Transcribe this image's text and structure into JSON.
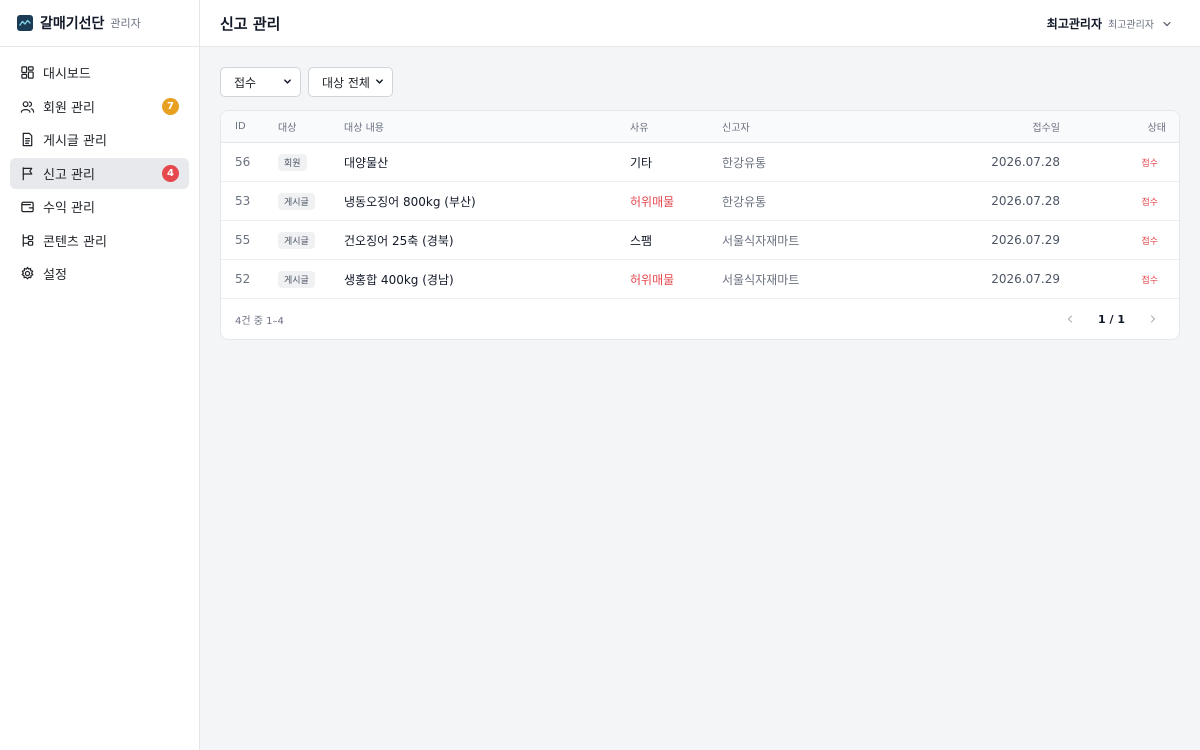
{
  "brand": {
    "name": "갈매기선단",
    "sub": "관리자"
  },
  "sidebar": {
    "items": [
      {
        "label": "대시보드",
        "icon": "dashboard-icon",
        "active": false,
        "badge": null
      },
      {
        "label": "회원 관리",
        "icon": "users-icon",
        "active": false,
        "badge": "7",
        "badge_color": "#e8a021"
      },
      {
        "label": "게시글 관리",
        "icon": "document-icon",
        "active": false,
        "badge": null
      },
      {
        "label": "신고 관리",
        "icon": "flag-icon",
        "active": true,
        "badge": "4",
        "badge_color": "#e5484d"
      },
      {
        "label": "수익 관리",
        "icon": "wallet-icon",
        "active": false,
        "badge": null
      },
      {
        "label": "콘텐츠 관리",
        "icon": "tree-icon",
        "active": false,
        "badge": null
      },
      {
        "label": "설정",
        "icon": "gear-icon",
        "active": false,
        "badge": null
      }
    ]
  },
  "header": {
    "title": "신고 관리",
    "user_name": "최고관리자",
    "user_role": "최고관리자"
  },
  "filters": {
    "status": "접수",
    "target": "대상 전체"
  },
  "table": {
    "columns": {
      "id": "ID",
      "type": "대상",
      "content": "대상 내용",
      "reason": "사유",
      "reporter": "신고자",
      "date": "접수일",
      "status": "상태"
    },
    "rows": [
      {
        "id": "56",
        "type": "회원",
        "content": "대양물산",
        "reason": "기타",
        "reason_alert": false,
        "reporter": "한강유통",
        "date": "2026.07.28",
        "status": "접수"
      },
      {
        "id": "53",
        "type": "게시글",
        "content": "냉동오징어 800kg (부산)",
        "reason": "허위매물",
        "reason_alert": true,
        "reporter": "한강유통",
        "date": "2026.07.28",
        "status": "접수"
      },
      {
        "id": "55",
        "type": "게시글",
        "content": "건오징어 25축 (경북)",
        "reason": "스팸",
        "reason_alert": false,
        "reporter": "서울식자재마트",
        "date": "2026.07.29",
        "status": "접수"
      },
      {
        "id": "52",
        "type": "게시글",
        "content": "생홍합 400kg (경남)",
        "reason": "허위매물",
        "reason_alert": true,
        "reporter": "서울식자재마트",
        "date": "2026.07.29",
        "status": "접수"
      }
    ]
  },
  "footer": {
    "count": "4건 중 1–4",
    "page": "1 / 1"
  },
  "colors": {
    "alert": "#e5484d",
    "accent": "#1c3b55"
  }
}
